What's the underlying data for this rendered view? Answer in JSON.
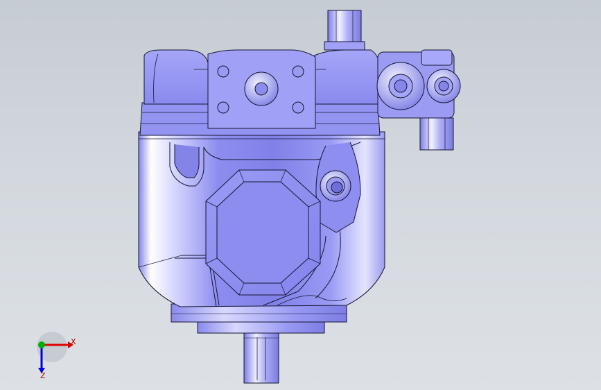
{
  "viewport": {
    "model": "hydraulic-pump-assembly",
    "colors": {
      "background_top": "#c6ccd3",
      "background_bottom": "#dde1e6",
      "body_shade": "#7f7fe6",
      "body_light": "#b9b9fb",
      "body_highlight": "#ffffff",
      "edge": "#141432",
      "axis_x": "#e00000",
      "axis_y": "#00b000",
      "axis_z": "#0000e0"
    }
  },
  "triad": {
    "x_label": "X",
    "z_label": "Z"
  }
}
